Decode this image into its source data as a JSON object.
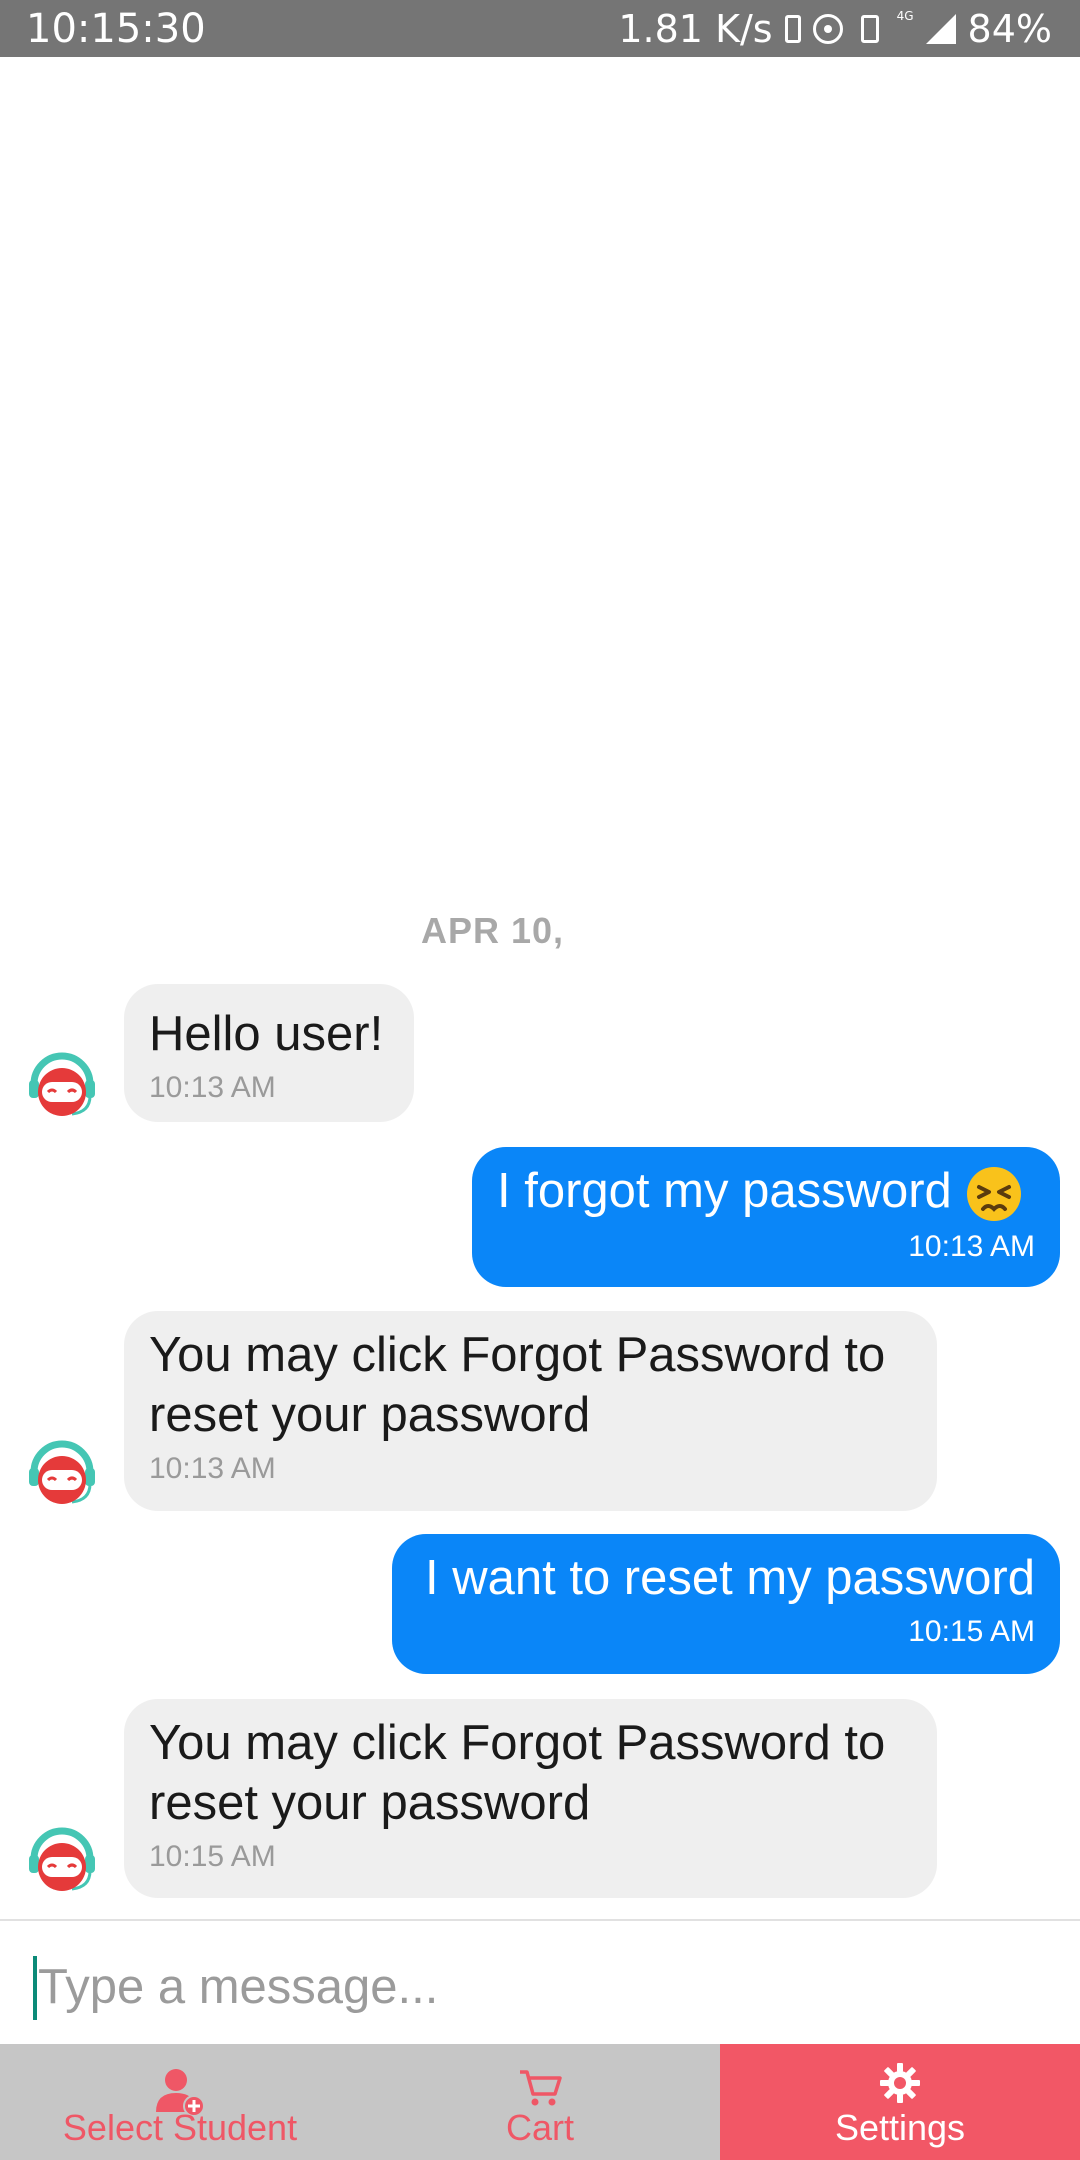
{
  "status_bar": {
    "time": "10:15:30",
    "speed": "1.81 K/s",
    "network": "4G",
    "battery": "84%"
  },
  "chat": {
    "date_separator": "APR 10,",
    "messages": [
      {
        "sender": "bot",
        "text": "Hello user!",
        "time": "10:13 AM"
      },
      {
        "sender": "user",
        "text": "I forgot my password",
        "emoji": "persevering-face",
        "time": "10:13 AM"
      },
      {
        "sender": "bot",
        "text": "You may click Forgot Password to reset your password",
        "time": "10:13 AM"
      },
      {
        "sender": "user",
        "text": "I want to reset my password",
        "time": "10:15 AM"
      },
      {
        "sender": "bot",
        "text": "You may click Forgot Password to reset your password",
        "time": "10:15 AM"
      }
    ]
  },
  "composer": {
    "placeholder": "Type a message..."
  },
  "bottom_nav": {
    "items": [
      {
        "label": "Select Student",
        "icon": "add-user-icon",
        "active": false
      },
      {
        "label": "Cart",
        "icon": "cart-icon",
        "active": false
      },
      {
        "label": "Settings",
        "icon": "gear-icon",
        "active": true
      }
    ]
  },
  "colors": {
    "status_bar": "#757575",
    "incoming_bubble": "#efefef",
    "outgoing_bubble": "#0a86f8",
    "nav_active": "#f25766",
    "nav_inactive": "#c6c6c6"
  }
}
